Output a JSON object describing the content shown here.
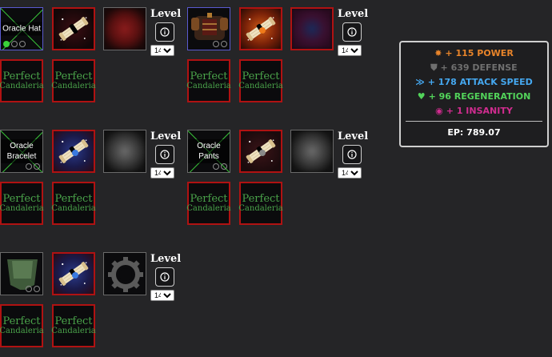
{
  "sets": [
    {
      "item_name": "Oracle Hat",
      "level_label": "Level",
      "level_value": "140",
      "bottom_left": {
        "line1": "Perfect",
        "line2": "Candaleria"
      },
      "bottom_right": {
        "line1": "Perfect",
        "line2": "Candaleria"
      }
    },
    {
      "level_label": "Level",
      "level_value": "140",
      "bottom_left": {
        "line1": "Perfect",
        "line2": "Candaleria"
      },
      "bottom_right": {
        "line1": "Perfect",
        "line2": "Candaleria"
      }
    },
    {
      "item_name": "Oracle Bracelet",
      "level_label": "Level",
      "level_value": "140",
      "bottom_left": {
        "line1": "Perfect",
        "line2": "Candaleria"
      },
      "bottom_right": {
        "line1": "Perfect",
        "line2": "Candaleria"
      }
    },
    {
      "item_name": "Oracle Pants",
      "level_label": "Level",
      "level_value": "140",
      "bottom_left": {
        "line1": "Perfect",
        "line2": "Candaleria"
      },
      "bottom_right": {
        "line1": "Perfect",
        "line2": "Candaleria"
      }
    },
    {
      "level_label": "Level",
      "level_value": "140",
      "bottom_left": {
        "line1": "Perfect",
        "line2": "Candaleria"
      },
      "bottom_right": {
        "line1": "Perfect",
        "line2": "Candaleria"
      }
    }
  ],
  "stats": {
    "power": "+ 115 POWER",
    "defense": "+ 639 DEFENSE",
    "attack_speed": "+ 178 ATTACK SPEED",
    "regeneration": "+ 96 REGENERATION",
    "insanity": "+ 1 INSANITY",
    "ep": "EP: 789.07"
  },
  "colors": {
    "power": "#e8842a",
    "defense": "#6f6f6f",
    "attack_speed": "#45a8f0",
    "regeneration": "#52d35a",
    "insanity": "#d02c8f",
    "slot_border_red": "#b01212",
    "oracle_line": "#38c238"
  }
}
